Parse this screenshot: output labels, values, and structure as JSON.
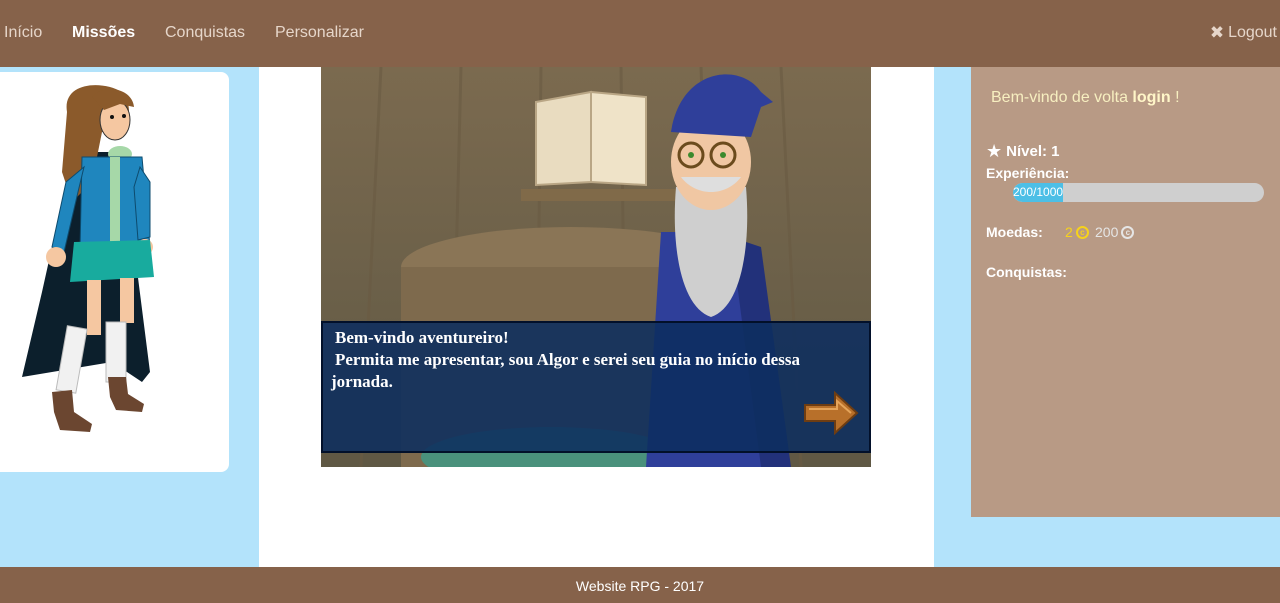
{
  "nav": {
    "items": [
      {
        "label": "Início"
      },
      {
        "label": "Missões"
      },
      {
        "label": "Conquistas"
      },
      {
        "label": "Personalizar"
      }
    ],
    "logout": "Logout"
  },
  "dialog": {
    "line1": "Bem-vindo aventureiro!",
    "line2": "Permita me apresentar, sou Algor e serei seu guia no início dessa jornada."
  },
  "stats": {
    "welcome_prefix": "Bem-vindo de volta",
    "username": "login",
    "welcome_suffix": "!",
    "level_label": "Nível: 1",
    "exp_label": "Experiência:",
    "exp_text": "200/1000",
    "exp_fraction": 0.2,
    "coins_label": "Moedas:",
    "coins_gold": "2",
    "coins_silver": "200",
    "achievements_label": "Conquistas:"
  },
  "footer": "Website RPG - 2017",
  "colors": {
    "nav_bg": "#86624a",
    "page_bg": "#b3e3fb",
    "panel_bg": "#b89a85",
    "dialog_bg": "#0c2d5f",
    "progress_fill": "#4cbfe6"
  },
  "icons": [
    "star-icon",
    "close-icon",
    "coin-icon",
    "next-arrow-icon"
  ]
}
